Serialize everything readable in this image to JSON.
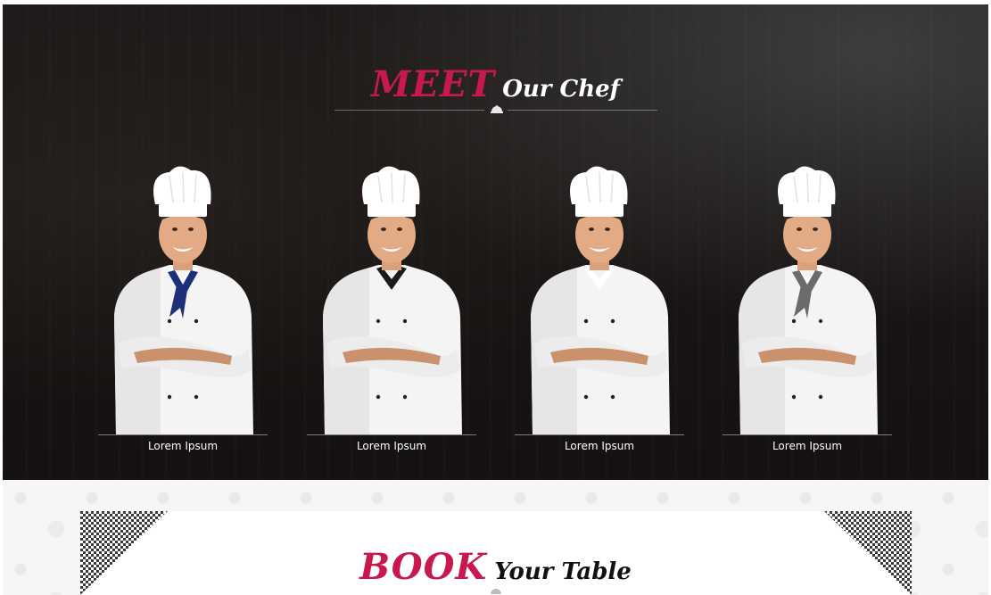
{
  "chef_section": {
    "heading_accent": "MEET",
    "heading_rest": "Our Chef",
    "chefs": [
      {
        "name": "Lorem Ipsum",
        "scarf": "#1e2f7a",
        "collar": "#ffffff"
      },
      {
        "name": "Lorem Ipsum",
        "scarf": "none",
        "collar": "#1a1a1a"
      },
      {
        "name": "Lorem Ipsum",
        "scarf": "none",
        "collar": "#ffffff"
      },
      {
        "name": "Lorem Ipsum",
        "scarf": "#6b6b6b",
        "collar": "#ffffff"
      }
    ]
  },
  "book_section": {
    "heading_accent": "BOOK",
    "heading_rest": "Your Table"
  },
  "colors": {
    "accent": "#c8194f",
    "dark_bg": "#1a1716"
  },
  "icons": [
    "cloche-icon"
  ]
}
